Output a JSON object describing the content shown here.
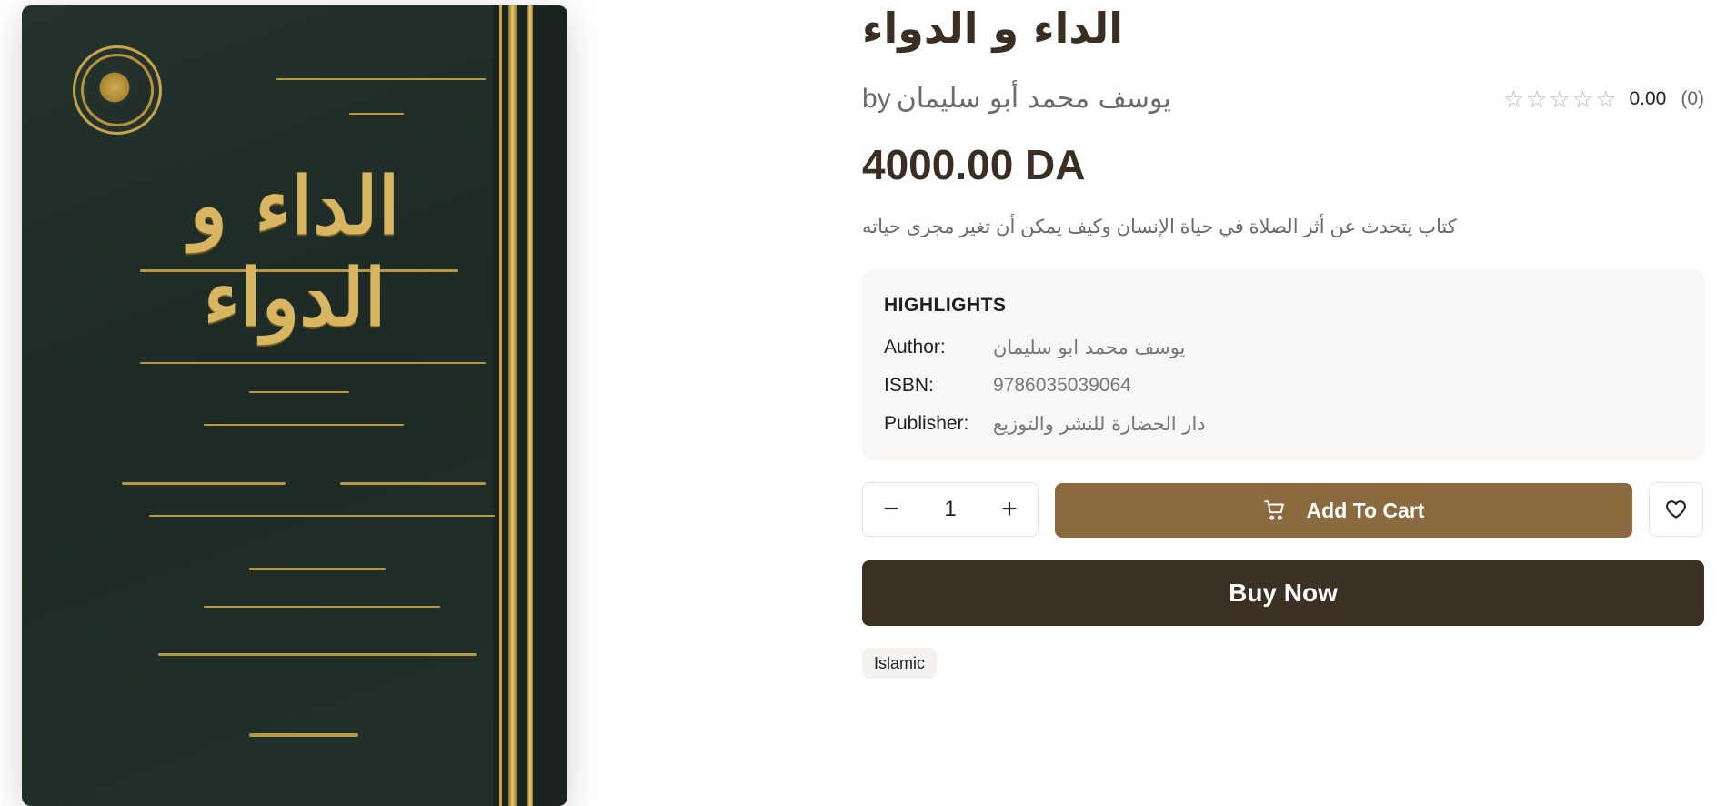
{
  "product": {
    "title": "الداء و الدواء",
    "by_label": "by",
    "author": "يوسف محمد أبو سليمان",
    "rating_value": "0.00",
    "rating_count": "(0)",
    "rating_stars": 0,
    "price": "4000.00 DA",
    "description": "كتاب يتحدث عن أثر الصلاة في حياة الإنسان وكيف يمكن أن تغير مجرى حياته"
  },
  "highlights": {
    "heading": "HIGHLIGHTS",
    "rows": [
      {
        "key": "Author:",
        "value": "يوسف محمد ابو سليمان"
      },
      {
        "key": "ISBN:",
        "value": "9786035039064"
      },
      {
        "key": "Publisher:",
        "value": "دار الحضارة للنشر والتوزيع"
      }
    ]
  },
  "actions": {
    "quantity": "1",
    "minus": "−",
    "plus": "+",
    "add_to_cart": "Add To Cart",
    "buy_now": "Buy Now"
  },
  "tags": [
    "Islamic"
  ],
  "colors": {
    "primary_brown": "#8b6a3f",
    "dark_brown": "#3c3022",
    "cover_green": "#24332e",
    "gold": "#d8b661"
  },
  "icons": [
    "cart-icon",
    "heart-icon",
    "star-outline-icon",
    "minus-icon",
    "plus-icon"
  ]
}
